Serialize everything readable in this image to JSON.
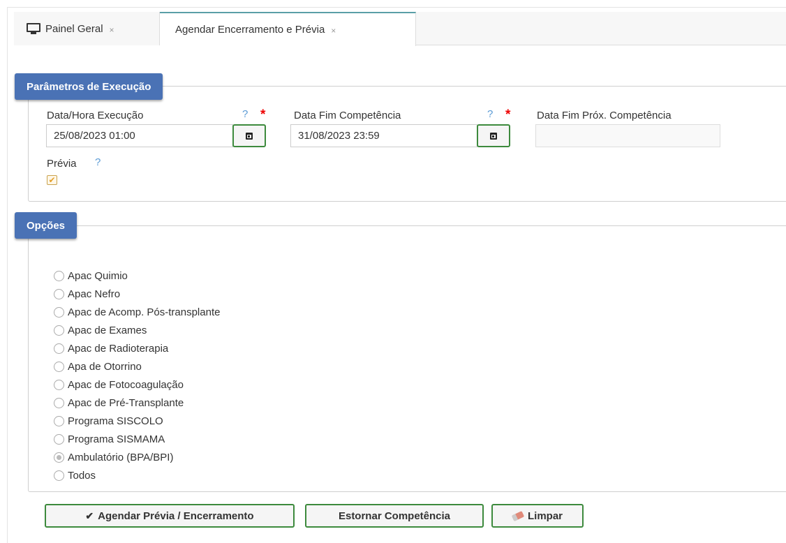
{
  "tabs": [
    {
      "label": "Painel Geral",
      "close": "×",
      "icon": "monitor-icon",
      "active": false
    },
    {
      "label": "Agendar Encerramento e Prévia",
      "close": "×",
      "active": true
    }
  ],
  "params": {
    "legend": "Parâmetros de Execução",
    "data_hora": {
      "label": "Data/Hora Execução",
      "help": "?",
      "required": "*",
      "value": "25/08/2023 01:00"
    },
    "data_fim": {
      "label": "Data Fim Competência",
      "help": "?",
      "required": "*",
      "value": "31/08/2023 23:59"
    },
    "data_fim_prox": {
      "label": "Data Fim Próx. Competência",
      "value": ""
    },
    "previa": {
      "label": "Prévia",
      "help": "?",
      "checked": true,
      "check_glyph": "✔"
    }
  },
  "options": {
    "legend": "Opções",
    "items": [
      {
        "label": "Apac Quimio",
        "checked": false
      },
      {
        "label": "Apac Nefro",
        "checked": false
      },
      {
        "label": "Apac de Acomp. Pós-transplante",
        "checked": false
      },
      {
        "label": "Apac de Exames",
        "checked": false
      },
      {
        "label": "Apac de Radioterapia",
        "checked": false
      },
      {
        "label": "Apa de Otorrino",
        "checked": false
      },
      {
        "label": "Apac de Fotocoagulação",
        "checked": false
      },
      {
        "label": "Apac de Pré-Transplante",
        "checked": false
      },
      {
        "label": "Programa SISCOLO",
        "checked": false
      },
      {
        "label": "Programa SISMAMA",
        "checked": false
      },
      {
        "label": "Ambulatório (BPA/BPI)",
        "checked": true
      },
      {
        "label": "Todos",
        "checked": false
      }
    ]
  },
  "buttons": {
    "agendar": {
      "label": "Agendar Prévia / Encerramento",
      "icon_glyph": "✔"
    },
    "estornar": {
      "label": "Estornar Competência"
    },
    "limpar": {
      "label": "Limpar"
    }
  },
  "colors": {
    "legend_bg": "#4a72b5",
    "button_border": "#3d8a3d",
    "help": "#5b9bd5",
    "required": "#e00000",
    "tab_accent": "#5a9fa7"
  }
}
